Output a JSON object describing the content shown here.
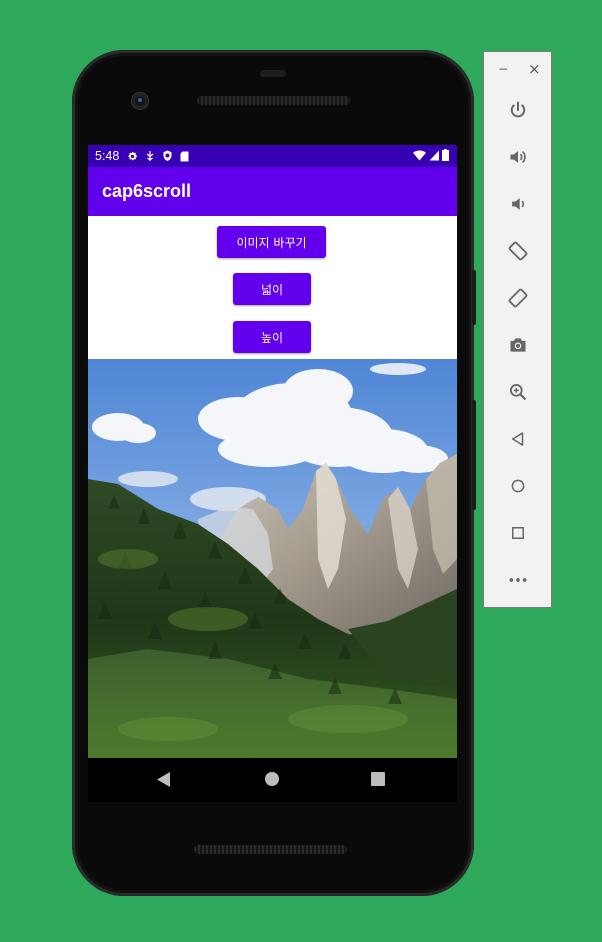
{
  "status_bar": {
    "time": "5:48",
    "left_icons": [
      "settings-icon",
      "usb-debug-icon",
      "shield-icon",
      "sd-card-icon"
    ],
    "right_icons": [
      "wifi-icon",
      "signal-icon",
      "battery-icon"
    ]
  },
  "app_bar": {
    "title": "cap6scroll"
  },
  "buttons": {
    "change_image": "이미지 바꾸기",
    "width": "넓이",
    "height": "높이"
  },
  "image": {
    "description": "mountain-landscape"
  },
  "nav_bar": {
    "items": [
      "back-icon",
      "home-icon",
      "recents-icon"
    ]
  },
  "emulator_panel": {
    "window_controls": {
      "minimize": "−",
      "close": "×"
    },
    "tools": [
      "power-icon",
      "volume-up-icon",
      "volume-down-icon",
      "rotate-left-icon",
      "rotate-right-icon",
      "screenshot-icon",
      "zoom-icon",
      "back-icon",
      "home-icon",
      "overview-icon",
      "more-icon"
    ]
  },
  "colors": {
    "background": "#2ea85b",
    "status_bar": "#3700b3",
    "primary": "#6200ee"
  }
}
